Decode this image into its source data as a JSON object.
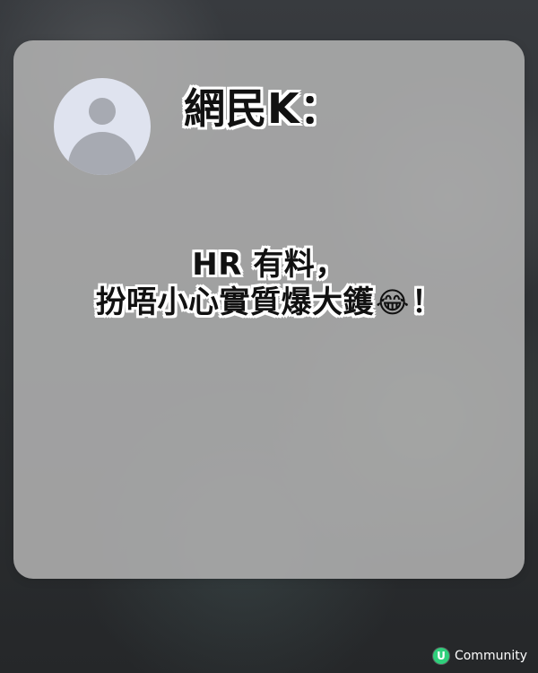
{
  "post": {
    "author": "網民K：",
    "line1": "HR 有料，",
    "line2_text": "扮唔小心實質爆大鑊",
    "line2_emoji": "😂",
    "line2_punct": "！"
  },
  "branding": {
    "logo_letter": "U",
    "logo_text": "Community"
  },
  "colors": {
    "card": "#b1b1b1",
    "avatar_bg": "#dfe3ef",
    "avatar_fg": "#a7aab2",
    "brand": "#2fcf7b"
  },
  "icons": {
    "avatar": "avatar-icon",
    "emoji": "laugh-cry-emoji-icon",
    "brand": "u-community-logo-icon"
  }
}
